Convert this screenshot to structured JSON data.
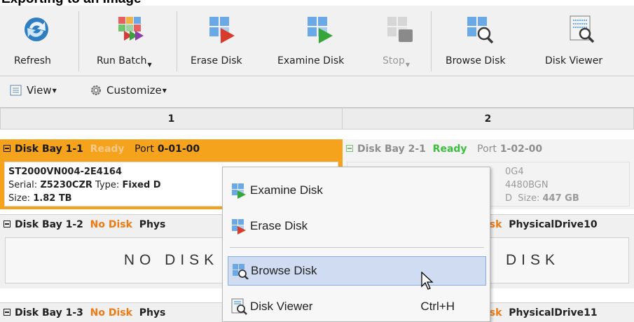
{
  "caption": "Exporting to an Image",
  "toolbar": {
    "buttons": [
      {
        "label": "Refresh",
        "dropdown": false,
        "enabled": true,
        "icon": "refresh-icon"
      },
      {
        "label": "Run Batch",
        "dropdown": true,
        "enabled": true,
        "icon": "run-batch-icon"
      },
      {
        "label": "Erase Disk",
        "dropdown": false,
        "enabled": true,
        "icon": "erase-disk-icon"
      },
      {
        "label": "Examine Disk",
        "dropdown": false,
        "enabled": true,
        "icon": "examine-disk-icon"
      },
      {
        "label": "Stop",
        "dropdown": true,
        "enabled": false,
        "icon": "stop-icon"
      },
      {
        "label": "Browse Disk",
        "dropdown": false,
        "enabled": true,
        "icon": "browse-disk-icon"
      },
      {
        "label": "Disk Viewer",
        "dropdown": false,
        "enabled": true,
        "icon": "disk-viewer-icon"
      }
    ],
    "view_label": "View",
    "customize_label": "Customize"
  },
  "columns": [
    "1",
    "2"
  ],
  "bays": {
    "b11": {
      "name": "Disk Bay 1-1",
      "status": "Ready",
      "port_label": "Port",
      "port": "0-01-00",
      "model": "ST2000VN004-2E4164",
      "serial_label": "Serial:",
      "serial": "Z5230CZR",
      "type_label": "Type:",
      "type": "Fixed D",
      "size_label": "Size:",
      "size": "1.82 TB"
    },
    "b21": {
      "name": "Disk Bay 2-1",
      "status": "Ready",
      "port_label": "Port",
      "port": "1-02-00",
      "line1": "0G4",
      "line2": "4480BGN",
      "line3_a": "D",
      "size_label": "Size:",
      "size": "447 GB"
    },
    "b12": {
      "name": "Disk Bay 1-2",
      "status": "No Disk",
      "phys": "Phys",
      "body": "NO DISK"
    },
    "b22": {
      "status_tail": "isk",
      "phys": "PhysicalDrive10",
      "body": "DISK"
    },
    "b13": {
      "name": "Disk Bay 1-3",
      "status": "No Disk",
      "phys": "Phys"
    },
    "b23": {
      "status_tail": "isk",
      "phys": "PhysicalDrive11"
    }
  },
  "context_menu": {
    "items": [
      {
        "label": "Examine Disk",
        "shortcut": "",
        "icon": "examine-disk-icon"
      },
      {
        "label": "Erase Disk",
        "shortcut": "",
        "icon": "erase-disk-icon"
      },
      {
        "label": "Browse Disk",
        "shortcut": "",
        "icon": "browse-disk-icon",
        "highlighted": true
      },
      {
        "label": "Disk Viewer",
        "shortcut": "Ctrl+H",
        "icon": "disk-viewer-icon"
      }
    ]
  },
  "colors": {
    "selected_bay": "#f5a21c",
    "ready": "#3cbf3c",
    "no_disk": "#f07a12",
    "menu_highlight": "#cfdcf2"
  }
}
